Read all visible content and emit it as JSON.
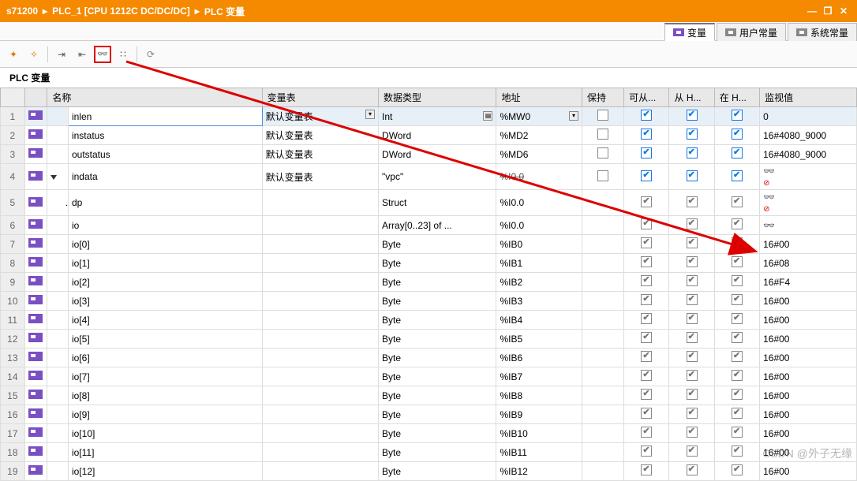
{
  "breadcrumb": {
    "a": "s71200",
    "b": "PLC_1 [CPU 1212C DC/DC/DC]",
    "c": "PLC 变量"
  },
  "tabs": {
    "t1": "变量",
    "t2": "用户常量",
    "t3": "系统常量"
  },
  "section_title": "PLC 变量",
  "cols": {
    "name": "名称",
    "table": "变量表",
    "dtype": "数据类型",
    "addr": "地址",
    "retain": "保持",
    "acc": "可从...",
    "fromh": "从 H...",
    "inh": "在 H...",
    "mon": "监视值"
  },
  "default_table": "默认变量表",
  "rows": [
    {
      "n": 1,
      "ico": "tag",
      "ind": 0,
      "tri": false,
      "name": "inlen",
      "table": true,
      "dtype": "Int",
      "addr": "%MW0",
      "dd": true,
      "ret": false,
      "c1": "blue",
      "c2": "blue",
      "c3": "blue",
      "mon": "0",
      "sel": true
    },
    {
      "n": 2,
      "ico": "tag",
      "ind": 0,
      "tri": false,
      "name": "instatus",
      "table": true,
      "dtype": "DWord",
      "addr": "%MD2",
      "ret": false,
      "c1": "blue",
      "c2": "blue",
      "c3": "blue",
      "mon": "16#4080_9000"
    },
    {
      "n": 3,
      "ico": "tag",
      "ind": 0,
      "tri": false,
      "name": "outstatus",
      "table": true,
      "dtype": "DWord",
      "addr": "%MD6",
      "ret": false,
      "c1": "blue",
      "c2": "blue",
      "c3": "blue",
      "mon": "16#4080_9000"
    },
    {
      "n": 4,
      "ico": "tag",
      "ind": 0,
      "tri": true,
      "name": "indata",
      "table": true,
      "dtype": "\"vpc\"",
      "addr": "%I0.0",
      "str": true,
      "ret": false,
      "c1": "blue",
      "c2": "blue",
      "c3": "blue",
      "mon": "__gn"
    },
    {
      "n": 5,
      "ico": "tag",
      "ind": 1,
      "tri": true,
      "name": "dp",
      "table": false,
      "dtype": "Struct",
      "addr": "%I0.0",
      "ret": null,
      "c1": "grey",
      "c2": "grey",
      "c3": "grey",
      "mon": "__gn"
    },
    {
      "n": 6,
      "ico": "tag",
      "ind": 2,
      "tri": true,
      "name": "io",
      "table": false,
      "dtype": "Array[0..23] of ...",
      "addr": "%I0.0",
      "ret": null,
      "c1": "grey",
      "c2": "grey",
      "c3": "grey",
      "mon": "__g"
    },
    {
      "n": 7,
      "ico": "tag",
      "ind": 3,
      "tri": false,
      "name": "io[0]",
      "table": false,
      "dtype": "Byte",
      "addr": "%IB0",
      "ret": null,
      "c1": "grey",
      "c2": "grey",
      "c3": "grey",
      "mon": "16#00"
    },
    {
      "n": 8,
      "ico": "tag",
      "ind": 3,
      "tri": false,
      "name": "io[1]",
      "table": false,
      "dtype": "Byte",
      "addr": "%IB1",
      "ret": null,
      "c1": "grey",
      "c2": "grey",
      "c3": "grey",
      "mon": "16#08"
    },
    {
      "n": 9,
      "ico": "tag",
      "ind": 3,
      "tri": false,
      "name": "io[2]",
      "table": false,
      "dtype": "Byte",
      "addr": "%IB2",
      "ret": null,
      "c1": "grey",
      "c2": "grey",
      "c3": "grey",
      "mon": "16#F4"
    },
    {
      "n": 10,
      "ico": "tag",
      "ind": 3,
      "tri": false,
      "name": "io[3]",
      "table": false,
      "dtype": "Byte",
      "addr": "%IB3",
      "ret": null,
      "c1": "grey",
      "c2": "grey",
      "c3": "grey",
      "mon": "16#00"
    },
    {
      "n": 11,
      "ico": "tag",
      "ind": 3,
      "tri": false,
      "name": "io[4]",
      "table": false,
      "dtype": "Byte",
      "addr": "%IB4",
      "ret": null,
      "c1": "grey",
      "c2": "grey",
      "c3": "grey",
      "mon": "16#00"
    },
    {
      "n": 12,
      "ico": "tag",
      "ind": 3,
      "tri": false,
      "name": "io[5]",
      "table": false,
      "dtype": "Byte",
      "addr": "%IB5",
      "ret": null,
      "c1": "grey",
      "c2": "grey",
      "c3": "grey",
      "mon": "16#00"
    },
    {
      "n": 13,
      "ico": "tag",
      "ind": 3,
      "tri": false,
      "name": "io[6]",
      "table": false,
      "dtype": "Byte",
      "addr": "%IB6",
      "ret": null,
      "c1": "grey",
      "c2": "grey",
      "c3": "grey",
      "mon": "16#00"
    },
    {
      "n": 14,
      "ico": "tag",
      "ind": 3,
      "tri": false,
      "name": "io[7]",
      "table": false,
      "dtype": "Byte",
      "addr": "%IB7",
      "ret": null,
      "c1": "grey",
      "c2": "grey",
      "c3": "grey",
      "mon": "16#00"
    },
    {
      "n": 15,
      "ico": "tag",
      "ind": 3,
      "tri": false,
      "name": "io[8]",
      "table": false,
      "dtype": "Byte",
      "addr": "%IB8",
      "ret": null,
      "c1": "grey",
      "c2": "grey",
      "c3": "grey",
      "mon": "16#00"
    },
    {
      "n": 16,
      "ico": "tag",
      "ind": 3,
      "tri": false,
      "name": "io[9]",
      "table": false,
      "dtype": "Byte",
      "addr": "%IB9",
      "ret": null,
      "c1": "grey",
      "c2": "grey",
      "c3": "grey",
      "mon": "16#00"
    },
    {
      "n": 17,
      "ico": "tag",
      "ind": 3,
      "tri": false,
      "name": "io[10]",
      "table": false,
      "dtype": "Byte",
      "addr": "%IB10",
      "ret": null,
      "c1": "grey",
      "c2": "grey",
      "c3": "grey",
      "mon": "16#00"
    },
    {
      "n": 18,
      "ico": "tag",
      "ind": 3,
      "tri": false,
      "name": "io[11]",
      "table": false,
      "dtype": "Byte",
      "addr": "%IB11",
      "ret": null,
      "c1": "grey",
      "c2": "grey",
      "c3": "grey",
      "mon": "16#00"
    },
    {
      "n": 19,
      "ico": "tag",
      "ind": 3,
      "tri": false,
      "name": "io[12]",
      "table": false,
      "dtype": "Byte",
      "addr": "%IB12",
      "ret": null,
      "c1": "grey",
      "c2": "grey",
      "c3": "grey",
      "mon": "16#00"
    }
  ],
  "watermark": "CSDN @外子无缘"
}
